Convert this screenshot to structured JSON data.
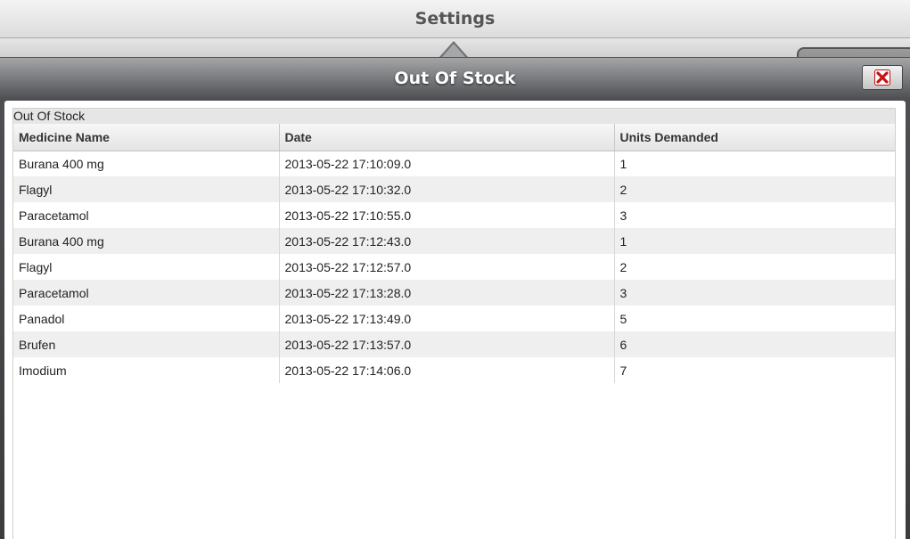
{
  "header": {
    "title": "Settings"
  },
  "dialog": {
    "title": "Out Of Stock",
    "close_icon": "close-x-icon",
    "close_icon_color": "#cc1111"
  },
  "grid": {
    "caption": "Out Of Stock",
    "columns": [
      "Medicine Name",
      "Date",
      "Units Demanded"
    ],
    "rows": [
      [
        "Burana 400 mg",
        "2013-05-22 17:10:09.0",
        "1"
      ],
      [
        "Flagyl",
        "2013-05-22 17:10:32.0",
        "2"
      ],
      [
        "Paracetamol",
        "2013-05-22 17:10:55.0",
        "3"
      ],
      [
        "Burana 400 mg",
        "2013-05-22 17:12:43.0",
        "1"
      ],
      [
        "Flagyl",
        "2013-05-22 17:12:57.0",
        "2"
      ],
      [
        "Paracetamol",
        "2013-05-22 17:13:28.0",
        "3"
      ],
      [
        "Panadol",
        "2013-05-22 17:13:49.0",
        "5"
      ],
      [
        "Brufen",
        "2013-05-22 17:13:57.0",
        "6"
      ],
      [
        "Imodium",
        "2013-05-22 17:14:06.0",
        "7"
      ]
    ]
  }
}
